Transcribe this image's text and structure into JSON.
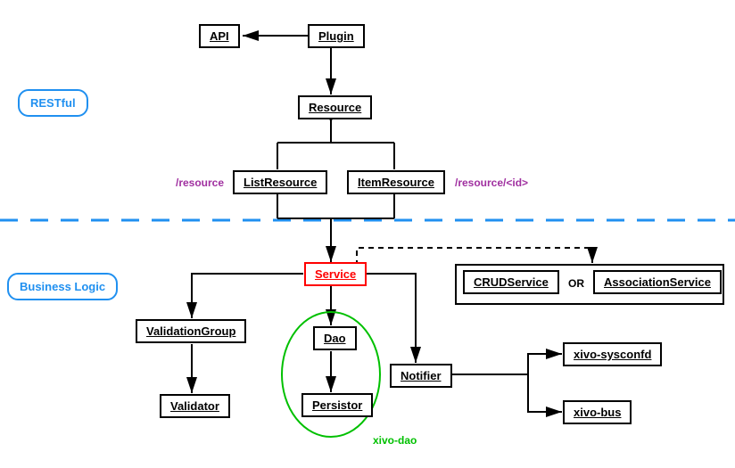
{
  "layers": {
    "restful": "RESTful",
    "business": "Business Logic"
  },
  "nodes": {
    "api": "API",
    "plugin": "Plugin",
    "resource": "Resource",
    "list_resource": "ListResource",
    "item_resource": "ItemResource",
    "service": "Service",
    "validation_group": "ValidationGroup",
    "validator": "Validator",
    "dao": "Dao",
    "persistor": "Persistor",
    "notifier": "Notifier",
    "crud_service": "CRUDService",
    "association_service": "AssociationService",
    "xivo_sysconfd": "xivo-sysconfd",
    "xivo_bus": "xivo-bus"
  },
  "labels": {
    "resource_path": "/resource",
    "item_path": "/resource/<id>",
    "or": "OR",
    "xivo_dao": "xivo-dao"
  },
  "colors": {
    "box_border": "#000000",
    "service_border": "#ff0000",
    "layer_border": "#2090f0",
    "dao_group": "#00c000",
    "path_label": "#a030a0",
    "divider": "#2090f0"
  },
  "edges": [
    {
      "from": "plugin",
      "to": "api",
      "style": "solid",
      "head": "arrow"
    },
    {
      "from": "plugin",
      "to": "resource",
      "style": "solid",
      "head": "arrow"
    },
    {
      "from": "list_resource",
      "to": "resource",
      "style": "solid",
      "head": "triangle",
      "shared": true
    },
    {
      "from": "item_resource",
      "to": "resource",
      "style": "solid",
      "head": "triangle",
      "shared": true
    },
    {
      "from": "list_resource_item_resource",
      "to": "service",
      "style": "solid",
      "head": "arrow"
    },
    {
      "from": "service",
      "to": "crud_service_association_service",
      "style": "dashed",
      "head": "arrow"
    },
    {
      "from": "service",
      "to": "validation_group",
      "style": "solid",
      "head": "arrow"
    },
    {
      "from": "service",
      "to": "dao",
      "style": "solid",
      "head": "arrow"
    },
    {
      "from": "service",
      "to": "notifier",
      "style": "solid",
      "head": "arrow"
    },
    {
      "from": "validation_group",
      "to": "validator",
      "style": "solid",
      "head": "arrow"
    },
    {
      "from": "dao",
      "to": "persistor",
      "style": "solid",
      "head": "arrow"
    },
    {
      "from": "notifier",
      "to": "xivo_sysconfd",
      "style": "solid",
      "head": "arrow"
    },
    {
      "from": "notifier",
      "to": "xivo_bus",
      "style": "solid",
      "head": "arrow"
    }
  ]
}
